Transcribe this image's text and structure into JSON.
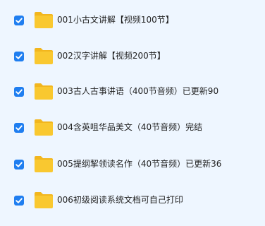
{
  "files": [
    {
      "name": "001小古文讲解【视频100节】",
      "checked": true,
      "icon": "folder-icon"
    },
    {
      "name": "002汉字讲解【视频200节】",
      "checked": true,
      "icon": "folder-icon"
    },
    {
      "name": "003古人古事讲语（400节音频）已更新90",
      "checked": true,
      "icon": "folder-icon"
    },
    {
      "name": "004含英咀华品美文（40节音频）完结",
      "checked": true,
      "icon": "folder-icon"
    },
    {
      "name": "005提纲挈领读名作（40节音频）已更新36",
      "checked": true,
      "icon": "folder-icon"
    },
    {
      "name": "006初级阅读系统文档可自己打印",
      "checked": true,
      "icon": "folder-icon"
    }
  ],
  "colors": {
    "background": "#eef6ff",
    "checkbox": "#1f7ef0",
    "folder": "#f9c830",
    "folder_back": "#f2b61e"
  }
}
